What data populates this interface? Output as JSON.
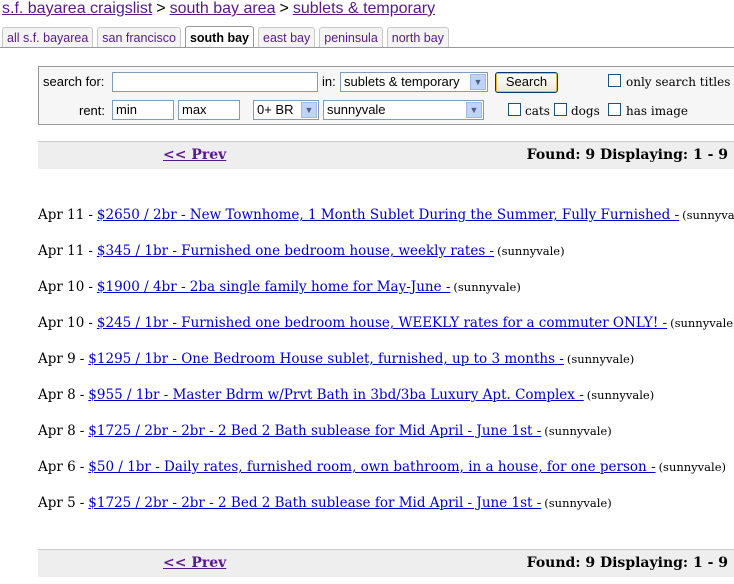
{
  "breadcrumb": [
    "s.f. bayarea craigslist",
    "south bay area",
    "sublets & temporary"
  ],
  "breadcrumb_sep": ">",
  "tabs": [
    {
      "label": "all s.f. bayarea",
      "active": false
    },
    {
      "label": "san francisco",
      "active": false
    },
    {
      "label": "south bay",
      "active": true
    },
    {
      "label": "east bay",
      "active": false
    },
    {
      "label": "peninsula",
      "active": false
    },
    {
      "label": "north bay",
      "active": false
    }
  ],
  "search": {
    "search_for_label": "search for:",
    "search_value": "",
    "in_label": "in:",
    "category_value": "sublets & temporary",
    "search_button": "Search",
    "only_titles_label": "only search titles",
    "rent_label": "rent:",
    "min_placeholder": "min",
    "max_placeholder": "max",
    "br_value": "0+ BR",
    "area_value": "sunnyvale",
    "cats_label": "cats",
    "dogs_label": "dogs",
    "has_image_label": "has image"
  },
  "pager": {
    "prev_label": "<< Prev",
    "found_text": "Found: 9 Displaying: 1 - 9"
  },
  "listings": [
    {
      "date": "Apr 11",
      "title": "$2650 / 2br - New Townhome, 1 Month Sublet During the Summer, Fully Furnished -",
      "loc": "(sunnyvale)"
    },
    {
      "date": "Apr 11",
      "title": "$345 / 1br - Furnished one bedroom house, weekly rates -",
      "loc": "(sunnyvale)"
    },
    {
      "date": "Apr 10",
      "title": "$1900 / 4br - 2ba single family home for May-June -",
      "loc": "(sunnyvale)"
    },
    {
      "date": "Apr 10",
      "title": "$245 / 1br - Furnished one bedroom house, WEEKLY rates for a commuter ONLY! -",
      "loc": "(sunnyvale)"
    },
    {
      "date": "Apr 9",
      "title": "$1295 / 1br - One Bedroom House sublet, furnished, up to 3 months -",
      "loc": "(sunnyvale)"
    },
    {
      "date": "Apr 8",
      "title": "$955 / 1br - Master Bdrm w/Prvt Bath in 3bd/3ba Luxury Apt. Complex -",
      "loc": "(sunnyvale)"
    },
    {
      "date": "Apr 8",
      "title": "$1725 / 2br - 2br - 2 Bed 2 Bath sublease for Mid April - June 1st -",
      "loc": "(sunnyvale)"
    },
    {
      "date": "Apr 6",
      "title": "$50 / 1br - Daily rates, furnished room, own bathroom, in a house, for one person -",
      "loc": "(sunnyvale)"
    },
    {
      "date": "Apr 5",
      "title": "$1725 / 2br - 2br - 2 Bed 2 Bath sublease for Mid April - June 1st -",
      "loc": "(sunnyvale)"
    }
  ],
  "date_sep": "-"
}
